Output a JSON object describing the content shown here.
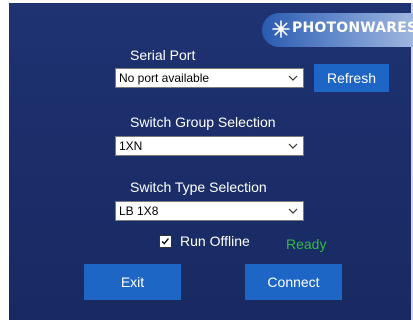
{
  "brand": {
    "logo_text": "PHOTONWARES"
  },
  "serial_port": {
    "label": "Serial Port",
    "selected": "No port available",
    "refresh_label": "Refresh"
  },
  "switch_group": {
    "label": "Switch Group Selection",
    "selected": "1XN"
  },
  "switch_type": {
    "label": "Switch Type Selection",
    "selected": "LB 1X8"
  },
  "run_offline": {
    "label": "Run Offline",
    "checked": true
  },
  "status": {
    "text": "Ready",
    "color": "#35b84a"
  },
  "actions": {
    "exit_label": "Exit",
    "connect_label": "Connect"
  },
  "colors": {
    "background": "#1b2e6a",
    "button": "#1e66c6",
    "accent_logo": "#2a5bb0"
  }
}
